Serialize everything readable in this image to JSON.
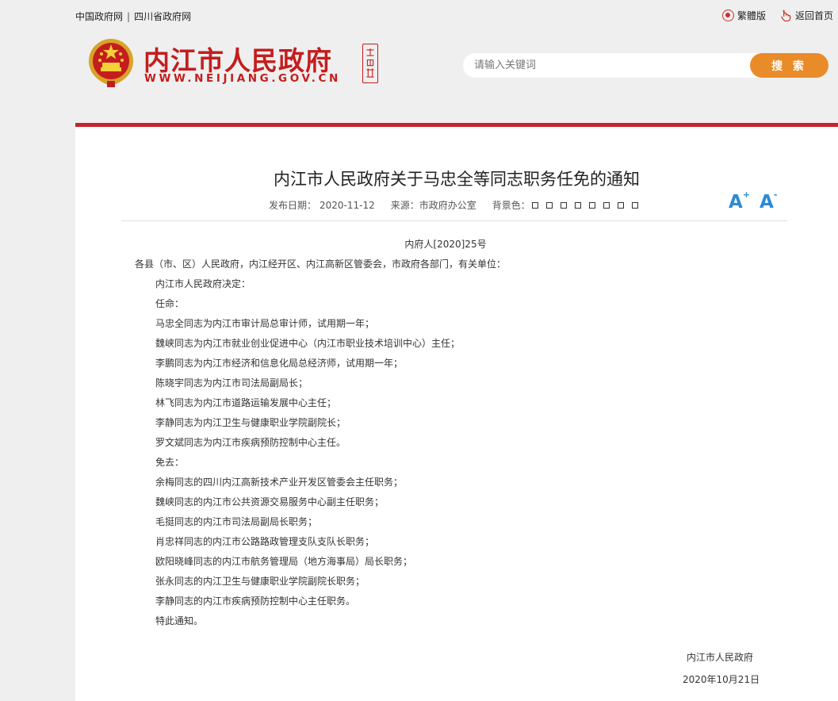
{
  "topbar": {
    "links": [
      "中国政府网",
      "四川省政府网"
    ],
    "separator": "|",
    "traditional_label": "繁體版",
    "home_label": "返回首页"
  },
  "header": {
    "site_name": "内江市人民政府",
    "site_url": "WWW.NEIJIANG.GOV.CN",
    "search_placeholder": "请输入关键词",
    "search_button": "搜 索",
    "brand_color": "#c41d1d",
    "accent_color": "#ea8b29"
  },
  "article": {
    "title": "内江市人民政府关于马忠全等同志职务任免的通知",
    "publish_label": "发布日期：",
    "publish_date": "2020-11-12",
    "source_label": "来源：",
    "source": "市政府办公室",
    "bg_color_label": "背景色：",
    "font_increase": "A",
    "font_decrease": "A",
    "font_increase_mark": "+",
    "font_decrease_mark": "-",
    "doc_number": "内府人[2020]25号",
    "recipients": "各县（市、区）人民政府，内江经开区、内江高新区管委会，市政府各部门，有关单位：",
    "body_lines": [
      "内江市人民政府决定：",
      "任命：",
      "马忠全同志为内江市审计局总审计师，试用期一年；",
      "魏峡同志为内江市就业创业促进中心（内江市职业技术培训中心）主任；",
      "李鹏同志为内江市经济和信息化局总经济师，试用期一年；",
      "陈晓宇同志为内江市司法局副局长；",
      "林飞同志为内江市道路运输发展中心主任；",
      "李静同志为内江卫生与健康职业学院副院长；",
      "罗文斌同志为内江市疾病预防控制中心主任。",
      "免去：",
      "余梅同志的四川内江高新技术产业开发区管委会主任职务；",
      "魏峡同志的内江市公共资源交易服务中心副主任职务；",
      "毛挺同志的内江市司法局副局长职务；",
      "肖忠祥同志的内江市公路路政管理支队支队长职务；",
      "欧阳晓峰同志的内江市航务管理局（地方海事局）局长职务；",
      "张永同志的内江卫生与健康职业学院副院长职务；",
      "李静同志的内江市疾病预防控制中心主任职务。",
      "特此通知。"
    ],
    "signer": "内江市人民政府",
    "sign_date": "2020年10月21日"
  }
}
